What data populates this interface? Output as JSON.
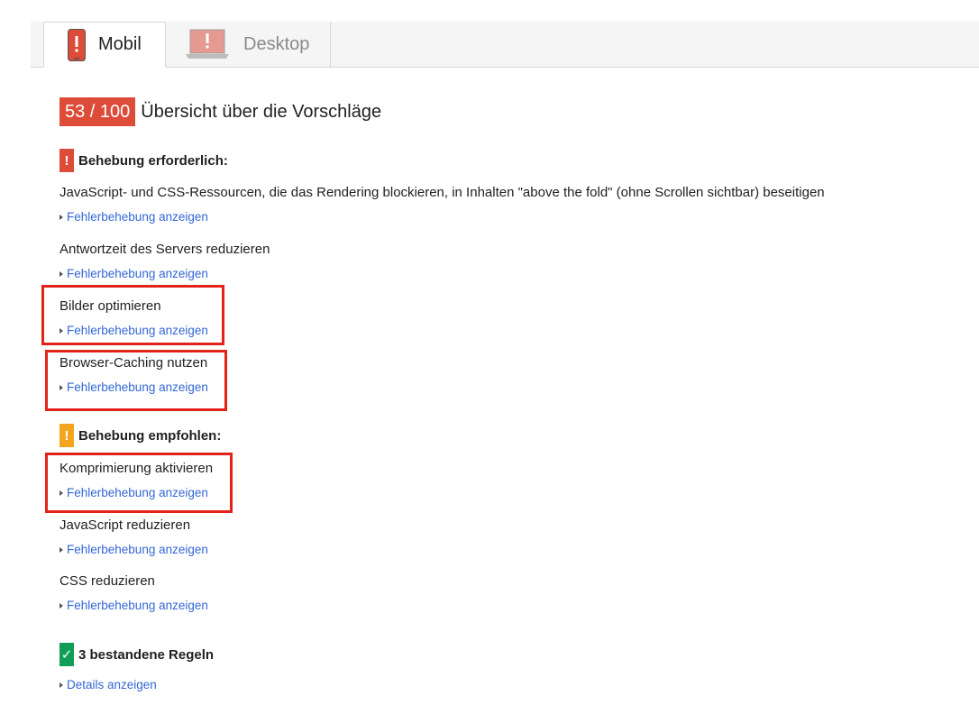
{
  "tabs": {
    "mobile_label": "Mobil",
    "desktop_label": "Desktop"
  },
  "score": {
    "value": "53 / 100",
    "title": "Übersicht über die Vorschläge"
  },
  "sections": {
    "required": {
      "badge": "!",
      "heading": "Behebung erforderlich:",
      "rules": [
        {
          "title": "JavaScript- und CSS-Ressourcen, die das Rendering blockieren, in Inhalten \"above the fold\" (ohne Scrollen sichtbar) beseitigen",
          "link": "Fehlerbehebung anzeigen"
        },
        {
          "title": "Antwortzeit des Servers reduzieren",
          "link": "Fehlerbehebung anzeigen"
        },
        {
          "title": "Bilder optimieren",
          "link": "Fehlerbehebung anzeigen"
        },
        {
          "title": "Browser-Caching nutzen",
          "link": "Fehlerbehebung anzeigen"
        }
      ]
    },
    "recommended": {
      "badge": "!",
      "heading": "Behebung empfohlen:",
      "rules": [
        {
          "title": "Komprimierung aktivieren",
          "link": "Fehlerbehebung anzeigen"
        },
        {
          "title": "JavaScript reduzieren",
          "link": "Fehlerbehebung anzeigen"
        },
        {
          "title": "CSS reduzieren",
          "link": "Fehlerbehebung anzeigen"
        }
      ]
    },
    "passed": {
      "badge": "✓",
      "heading": "3 bestandene Regeln",
      "link": "Details anzeigen"
    }
  },
  "colors": {
    "score_badge": "#dd4b39",
    "required_badge": "#dd4b39",
    "recommended_badge": "#f4a520",
    "passed_badge": "#0f9d58",
    "link": "#3367d6",
    "highlight": "#e2231a"
  }
}
